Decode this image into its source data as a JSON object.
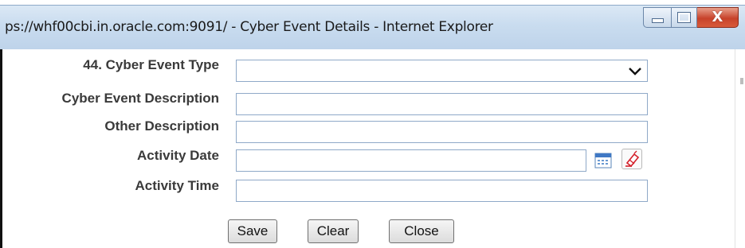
{
  "window": {
    "title": "ps://whf00cbi.in.oracle.com:9091/ - Cyber Event Details - Internet Explorer",
    "close_glyph": "X"
  },
  "form": {
    "cyber_event_type": {
      "label": "44. Cyber Event Type",
      "value": ""
    },
    "cyber_event_description": {
      "label": "Cyber Event Description",
      "value": ""
    },
    "other_description": {
      "label": "Other Description",
      "value": ""
    },
    "activity_date": {
      "label": "Activity Date",
      "value": ""
    },
    "activity_time": {
      "label": "Activity Time",
      "value": ""
    }
  },
  "buttons": {
    "save": "Save",
    "clear": "Clear",
    "close": "Close"
  },
  "icons": {
    "calendar": "calendar-icon",
    "clear_date": "eraser-icon"
  }
}
